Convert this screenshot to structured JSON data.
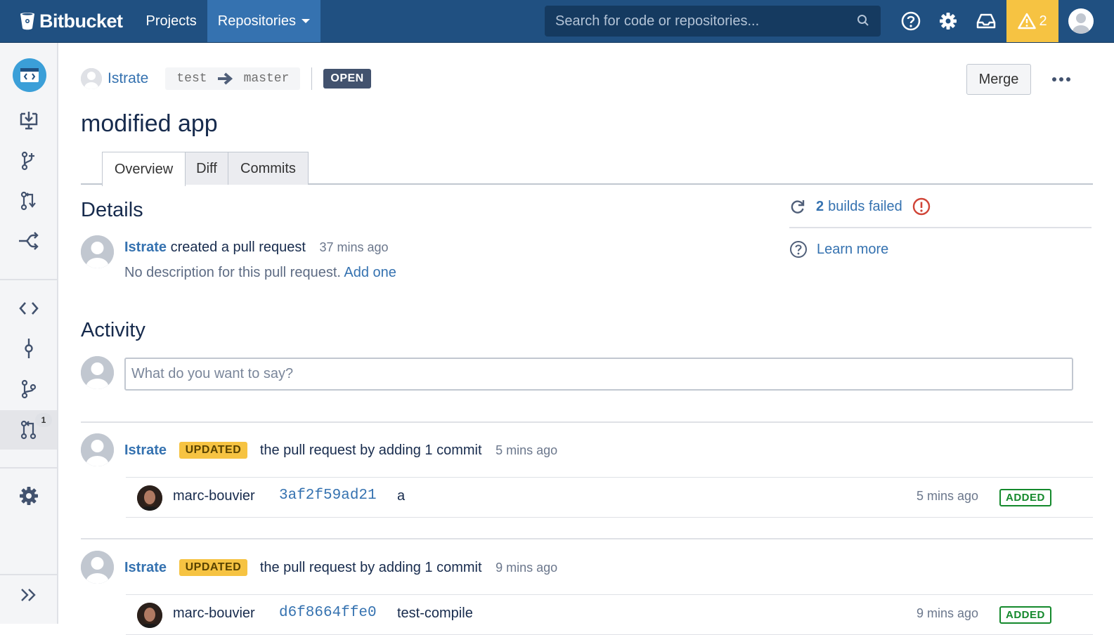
{
  "topbar": {
    "brand": "Bitbucket",
    "nav": [
      {
        "label": "Projects"
      },
      {
        "label": "Repositories"
      }
    ],
    "search_placeholder": "Search for code or repositories...",
    "notification_count": "2",
    "colors": {
      "bar": "#205081",
      "active": "#3572b0",
      "warning": "#f6c342"
    }
  },
  "sidebar": {
    "pull_request_badge": "1",
    "icons": [
      "repo-avatar",
      "clone-icon",
      "create-branch-icon",
      "create-pull-request-icon",
      "fork-icon",
      "source-icon",
      "commits-icon",
      "branches-icon",
      "pull-requests-icon",
      "settings-icon",
      "expand-icon"
    ]
  },
  "pr": {
    "author": "Istrate",
    "source_branch": "test",
    "target_branch": "master",
    "status": "OPEN",
    "merge_label": "Merge",
    "title": "modified app",
    "tabs": [
      {
        "label": "Overview"
      },
      {
        "label": "Diff"
      },
      {
        "label": "Commits"
      }
    ]
  },
  "details": {
    "heading": "Details",
    "author": "Istrate",
    "action": "created a pull request",
    "time": "37 mins ago",
    "description": "No description for this pull request.",
    "add_link": "Add one"
  },
  "side_panel": {
    "builds_count": "2",
    "builds_text": "builds failed",
    "learn_more": "Learn more"
  },
  "activity": {
    "heading": "Activity",
    "comment_placeholder": "What do you want to say?",
    "entries": [
      {
        "author": "Istrate",
        "badge": "UPDATED",
        "text": "the pull request by adding 1 commit",
        "time": "5 mins ago",
        "commit": {
          "author": "marc-bouvier",
          "hash": "3af2f59ad21",
          "message": "a",
          "time": "5 mins ago",
          "status": "ADDED"
        }
      },
      {
        "author": "Istrate",
        "badge": "UPDATED",
        "text": "the pull request by adding 1 commit",
        "time": "9 mins ago",
        "commit": {
          "author": "marc-bouvier",
          "hash": "d6f8664ffe0",
          "message": "test-compile",
          "time": "9 mins ago",
          "status": "ADDED"
        }
      }
    ]
  }
}
